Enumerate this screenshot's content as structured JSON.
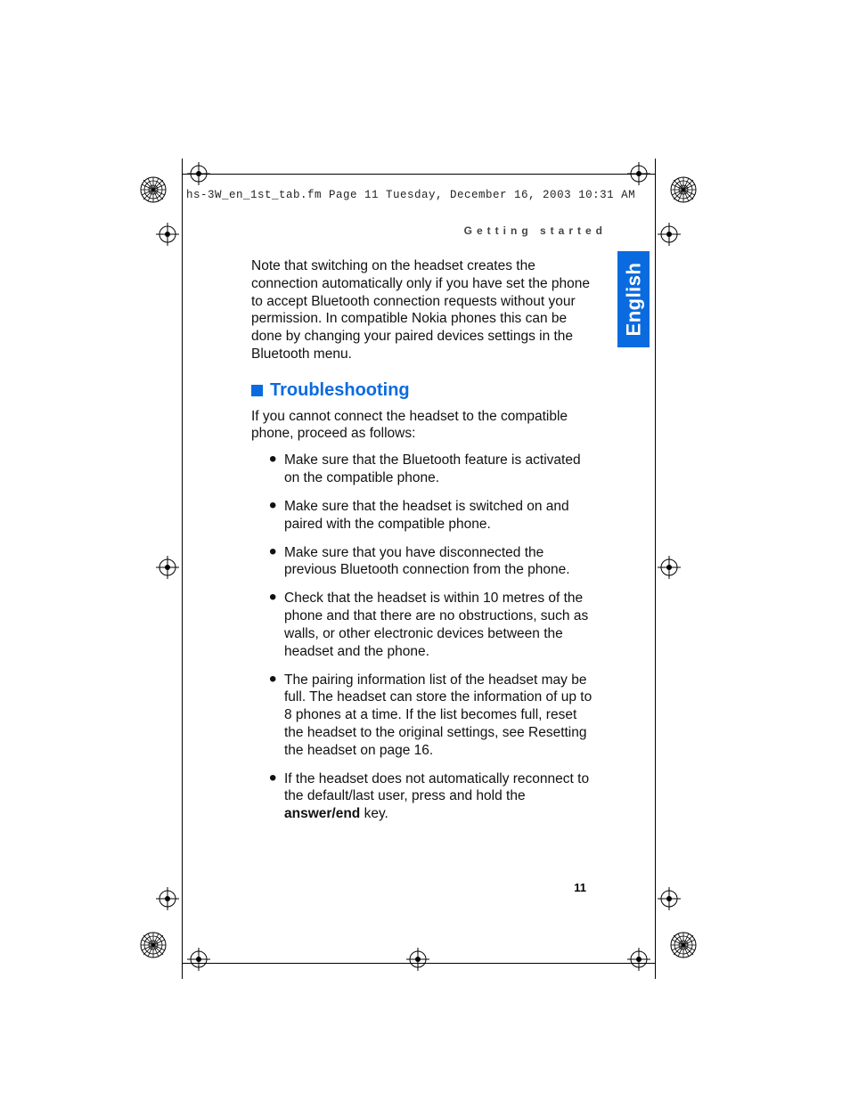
{
  "header_line": "hs-3W_en_1st_tab.fm  Page 11  Tuesday, December 16, 2003  10:31 AM",
  "running_head": "Getting started",
  "language_tab": "English",
  "intro_paragraph": "Note that switching on the headset creates the connection automatically only if you have set the phone to accept Bluetooth connection requests without your permission. In compatible Nokia phones this can be done by changing your paired devices settings in the Bluetooth menu.",
  "section_heading": "Troubleshooting",
  "lead_paragraph": "If you cannot connect the headset to the compatible phone, proceed as follows:",
  "bullets": [
    "Make sure that the Bluetooth feature is activated on the compatible phone.",
    "Make sure that the headset is switched on and paired with the compatible phone.",
    "Make sure that you have disconnected the previous Bluetooth connection from the phone.",
    "Check that the headset is within 10 metres of the phone and that there are no obstructions, such as walls, or other electronic devices between the headset and the phone.",
    "The pairing information list of the headset may be full. The headset can store the information of up to 8 phones at a time. If the list becomes full, reset the headset to the original settings, see Resetting the headset on page 16."
  ],
  "last_bullet_pre": "If the headset does not automatically reconnect to the default/last user, press and hold the ",
  "last_bullet_bold": "answer/end",
  "last_bullet_post": " key.",
  "page_number": "11"
}
